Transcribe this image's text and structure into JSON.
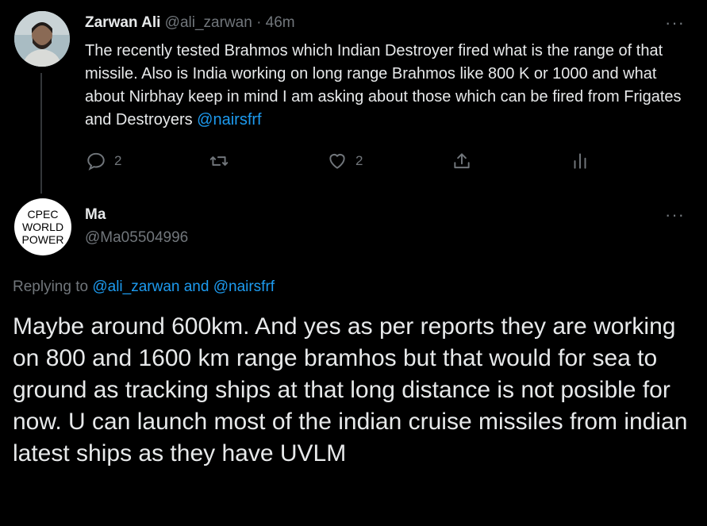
{
  "tweet1": {
    "author_name": "Zarwan Ali",
    "handle": "@ali_zarwan",
    "separator": "·",
    "time": "46m",
    "text": "The recently tested Brahmos which Indian Destroyer fired what is the range of that missile. Also is India working on long range Brahmos like 800 K or 1000 and what about Nirbhay keep in mind I am asking about those which can be fired from Frigates and Destroyers ",
    "mention": "@nairsfrf",
    "more_label": "···",
    "actions": {
      "reply_icon": "reply-icon",
      "reply_count": "2",
      "retweet_icon": "retweet-icon",
      "like_icon": "heart-icon",
      "like_count": "2",
      "share_icon": "share-icon",
      "analytics_icon": "analytics-icon"
    }
  },
  "tweet2": {
    "author_name": "Ma",
    "handle": "@Ma05504996",
    "more_label": "···",
    "avatar_text": [
      "CPEC",
      "WORLD",
      "POWER"
    ],
    "replying_prefix": "Replying to ",
    "replying_to": "@ali_zarwan and @nairsfrf",
    "text": "Maybe around 600km. And yes as per reports they are working on 800 and 1600 km range bramhos but that would for sea to ground as tracking ships at that long distance is not posible for now. U can launch most of the indian cruise missiles from indian latest ships as they have UVLM"
  },
  "colors": {
    "background": "#000000",
    "text": "#e7e9ea",
    "muted": "#71767b",
    "link": "#1d9bf0"
  }
}
